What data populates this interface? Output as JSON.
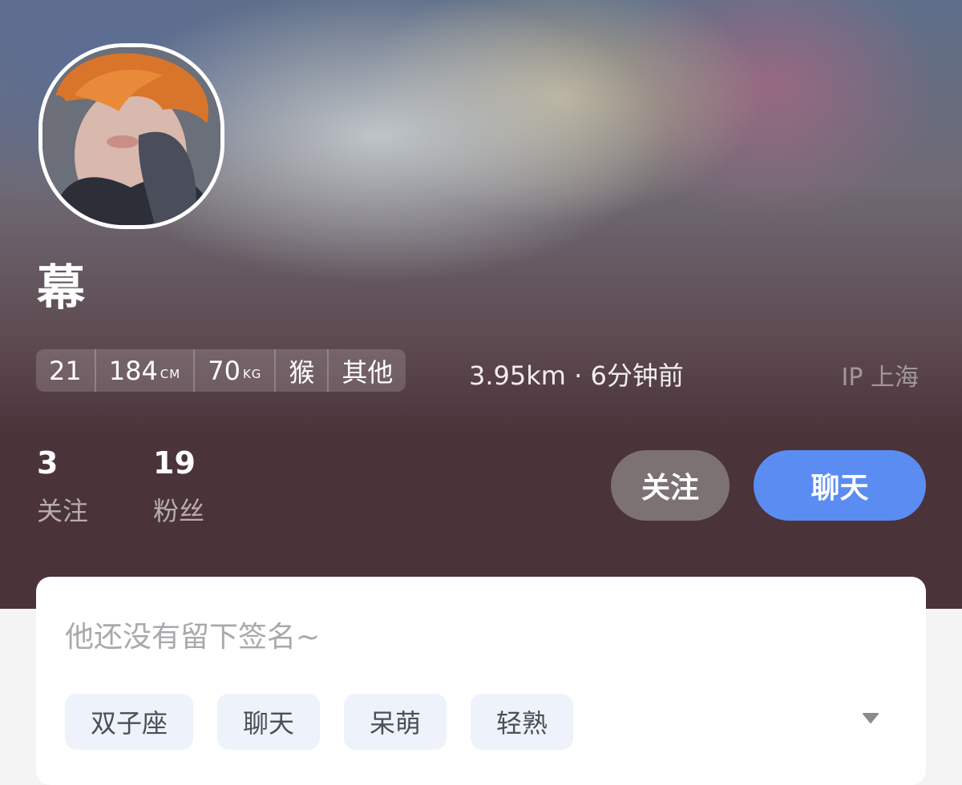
{
  "profile": {
    "name": "幕",
    "attributes": [
      {
        "value": "21",
        "unit": ""
      },
      {
        "value": "184",
        "unit": "CM"
      },
      {
        "value": "70",
        "unit": "KG"
      },
      {
        "value": "猴",
        "unit": ""
      },
      {
        "value": "其他",
        "unit": ""
      }
    ],
    "distance_time": "3.95km · 6分钟前",
    "ip_location": "IP 上海",
    "avatar_icon": "user-photo-avatar"
  },
  "stats": {
    "following": {
      "count": "3",
      "label": "关注"
    },
    "followers": {
      "count": "19",
      "label": "粉丝"
    }
  },
  "actions": {
    "follow_label": "关注",
    "chat_label": "聊天"
  },
  "bio": {
    "signature": "他还没有留下签名~",
    "tags": [
      "双子座",
      "聊天",
      "呆萌",
      "轻熟"
    ],
    "expand_icon": "triangle-down-icon"
  },
  "colors": {
    "hero_bg": "#4a3339",
    "chat_button": "#5b8cf2",
    "follow_button": "#7c7173",
    "tag_bg": "#eef2fb"
  }
}
